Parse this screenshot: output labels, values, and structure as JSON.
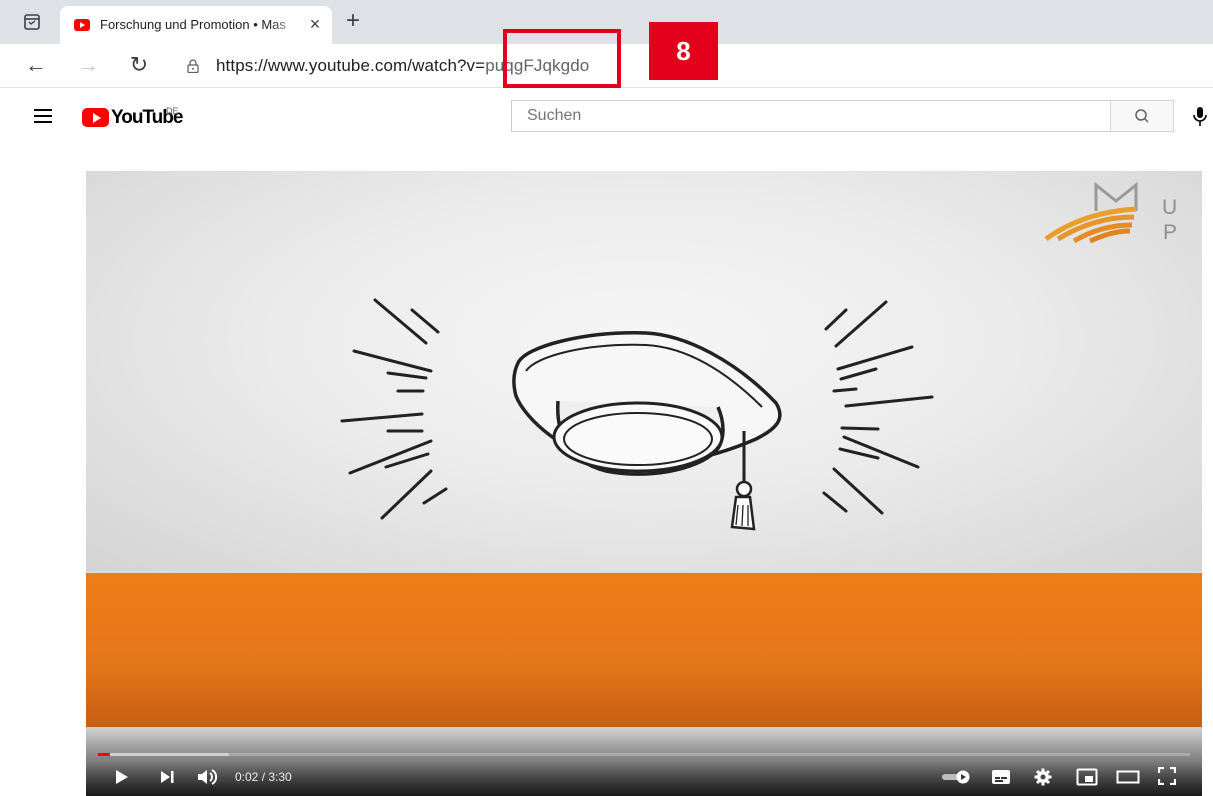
{
  "browser": {
    "tab_title": "Forschung und Promotion • Mas",
    "url_main": "https://www.youtube.com/watch?v=",
    "url_id": "puqgFJqkgdo"
  },
  "annotation": {
    "badge_label": "8",
    "accent_color": "#e3001b"
  },
  "youtube": {
    "logo_text": "YouTube",
    "region": "DE",
    "search_placeholder": "Suchen"
  },
  "video": {
    "time_display": "0:02 / 3:30",
    "progress_fraction": 0.0095,
    "buffered_fraction": 0.12,
    "watermark_letters": [
      "U",
      "P"
    ],
    "band_color": "#ef7d17"
  },
  "icons": {
    "tab_actions": "tab-actions-icon",
    "favicon": "youtube-favicon-icon",
    "close": "close-icon",
    "new_tab": "plus-icon",
    "back": "arrow-left-icon",
    "forward": "arrow-right-icon",
    "reload": "reload-icon",
    "lock": "lock-icon",
    "menu": "hamburger-icon",
    "search": "search-icon",
    "mic": "microphone-icon",
    "play": "play-icon",
    "next": "skip-next-icon",
    "volume": "volume-icon",
    "autoplay": "autoplay-toggle-icon",
    "subtitles": "subtitles-icon",
    "settings": "gear-icon",
    "miniplayer": "miniplayer-icon",
    "theater": "theater-mode-icon",
    "fullscreen": "fullscreen-icon"
  }
}
